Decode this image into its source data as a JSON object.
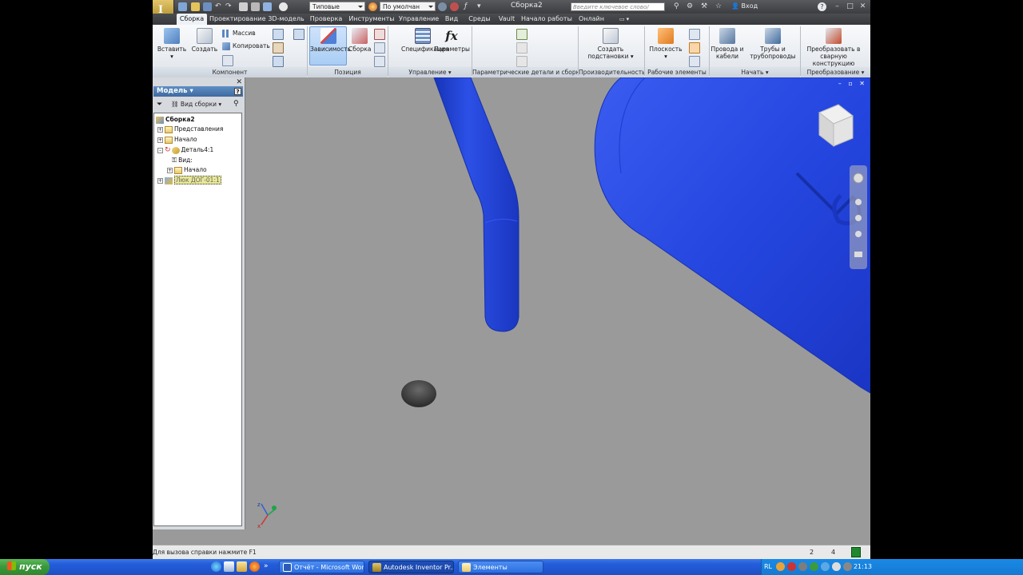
{
  "titlebar": {
    "document_title": "Сборка2",
    "appearance_combo": "Типовые",
    "material_combo": "По умолчан",
    "help_search_placeholder": "Введите ключевое слово/фразу",
    "login_label": "Вход"
  },
  "tabs": [
    "Сборка",
    "Проектирование",
    "3D-модель",
    "Проверка",
    "Инструменты",
    "Управление",
    "Вид",
    "Среды",
    "Vault",
    "Начало работы",
    "Онлайн"
  ],
  "active_tab": "Сборка",
  "ribbon": {
    "component": {
      "title": "Компонент",
      "insert_label": "Вставить",
      "create_label": "Создать",
      "pattern_label": "Массив",
      "copy_label": "Копировать"
    },
    "position": {
      "title": "Позиция",
      "constraint_label": "Зависимость",
      "assemble_label": "Сборка"
    },
    "manage": {
      "title": "Управление",
      "bom_label": "Спецификация",
      "params_label": "Параметры"
    },
    "parametric": {
      "title": "Параметрические детали и сборки"
    },
    "productivity": {
      "title": "Производительность",
      "substitute_label_line1": "Создать",
      "substitute_label_line2": "подстановки"
    },
    "work_features": {
      "title": "Рабочие элементы",
      "plane_label": "Плоскость"
    },
    "begin": {
      "title": "Начать",
      "cables_line1": "Провода и",
      "cables_line2": "кабели",
      "pipes_line1": "Трубы и",
      "pipes_line2": "трубопроводы"
    },
    "convert": {
      "title": "Преобразование",
      "weld_line1": "Преобразовать в",
      "weld_line2": "сварную конструкцию"
    }
  },
  "browser": {
    "header": "Модель",
    "view_combo": "Вид сборки",
    "tree": {
      "root": "Сборка2",
      "representations": "Представления",
      "origin": "Начало",
      "part": "Деталь4:1",
      "view": "Вид:",
      "part_origin": "Начало",
      "selected": "Люк ДОГ-01:1"
    }
  },
  "statusbar": {
    "help_text": "Для вызова справки нажмите F1",
    "count1": "2",
    "count2": "4"
  },
  "taskbar": {
    "start_label": "пуск",
    "tasks": [
      {
        "label": "Отчёт - Microsoft Word",
        "icon": "word-icon"
      },
      {
        "label": "Autodesk Inventor Pr...",
        "icon": "inventor-icon"
      },
      {
        "label": "Элементы",
        "icon": "folder-icon"
      }
    ],
    "language": "RL",
    "clock": "21:13"
  },
  "colors": {
    "model_blue": "#2244d8",
    "viewport_bg": "#9a9a9a",
    "taskbar_blue": "#245edb"
  }
}
